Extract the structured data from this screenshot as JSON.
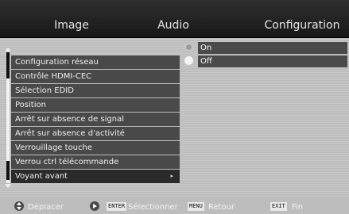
{
  "tabs": [
    {
      "label": "Image"
    },
    {
      "label": "Audio"
    },
    {
      "label": "Configuration"
    }
  ],
  "options": [
    {
      "label": "On",
      "state": "unselected"
    },
    {
      "label": "Off",
      "state": "selected"
    }
  ],
  "menu": {
    "items": [
      {
        "label": "Configuration réseau"
      },
      {
        "label": "Contrôle HDMI-CEC"
      },
      {
        "label": "Sélection EDID"
      },
      {
        "label": "Position"
      },
      {
        "label": "Arrêt sur absence de signal"
      },
      {
        "label": "Arrêt sur absence d'activité"
      },
      {
        "label": "Verrouillage touche"
      },
      {
        "label": "Verrou ctrl télécommande"
      },
      {
        "label": "Voyant avant",
        "arrow": "▸",
        "selected": true
      }
    ]
  },
  "footer": {
    "move_label": "Déplacer",
    "enter_key": "ENTER",
    "select_label": "Sélectionner",
    "menu_key": "MENU",
    "back_label": "Retour",
    "exit_key": "EXIT",
    "end_label": "Fin"
  },
  "colors": {
    "background": "#bdbdbd",
    "tab_bar": "#1e1e1e",
    "menu_item": "#494949",
    "menu_item_selected": "#2a2a2a"
  }
}
